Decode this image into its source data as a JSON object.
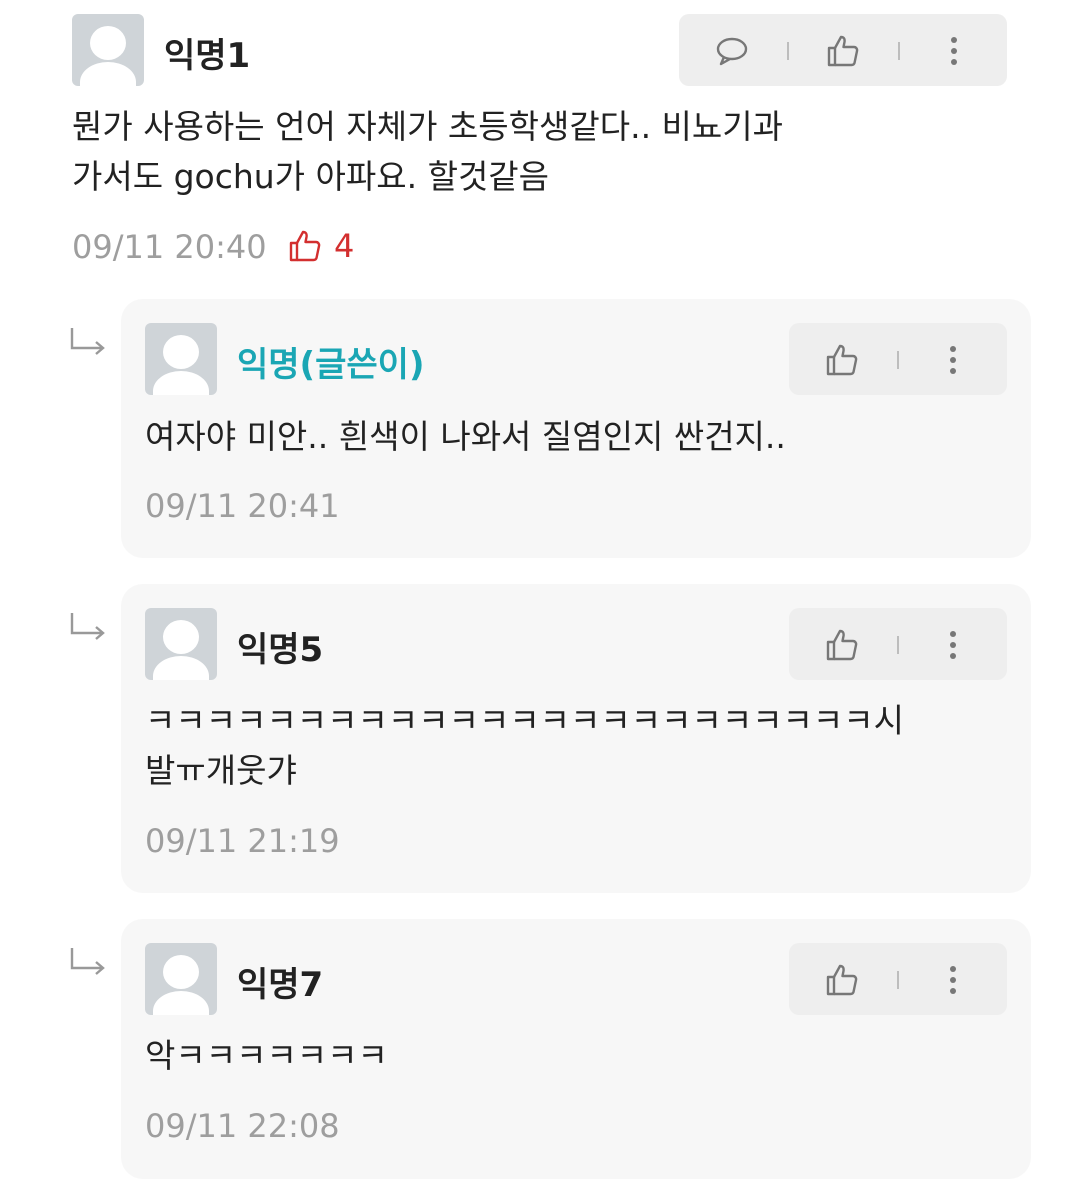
{
  "comment": {
    "author": "익명1",
    "text_lines": [
      "뭔가 사용하는 언어 자체가 초등학생같다.. 비뇨기과",
      "가서도 gochu가 아파요. 할것같음"
    ],
    "time": "09/11 20:40",
    "like_count": "4",
    "like_color": "#d32f2f"
  },
  "replies": [
    {
      "author": "익명(글쓴이)",
      "is_author": true,
      "text_lines": [
        "여자야 미안.. 흰색이 나와서 질염인지 싼건지.."
      ],
      "time": "09/11 20:41"
    },
    {
      "author": "익명5",
      "is_author": false,
      "text_lines": [
        "ㅋㅋㅋㅋㅋㅋㅋㅋㅋㅋㅋㅋㅋㅋㅋㅋㅋㅋㅋㅋㅋㅋㅋㅋ시",
        "발ㅠ개웃갸"
      ],
      "time": "09/11 21:19"
    },
    {
      "author": "익명7",
      "is_author": false,
      "text_lines": [
        "악ㅋㅋㅋㅋㅋㅋㅋ"
      ],
      "time": "09/11 22:08"
    }
  ],
  "icons": {
    "reply": "speech-bubble-icon",
    "like": "thumbs-up-icon",
    "more": "more-vertical-icon",
    "reply_indicator": "reply-arrow-icon",
    "avatar": "default-avatar"
  },
  "colors": {
    "author_name": "#1aa6b4",
    "reply_bg": "#f7f7f7",
    "action_bg": "#eeeeee",
    "timestamp": "#9e9e9e"
  }
}
